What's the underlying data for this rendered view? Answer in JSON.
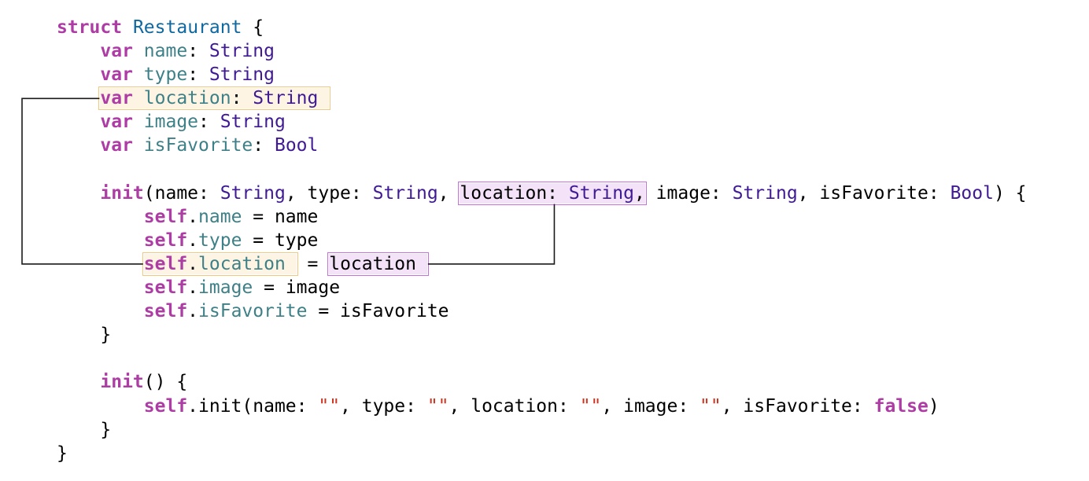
{
  "code_lines": [
    {
      "indent": 0,
      "tokens": [
        {
          "text": "struct",
          "kind": "struct"
        },
        {
          "text": " ",
          "kind": "plain"
        },
        {
          "text": "Restaurant",
          "kind": "typedef"
        },
        {
          "text": " {",
          "kind": "plain"
        }
      ]
    },
    {
      "indent": 1,
      "tokens": [
        {
          "text": "var",
          "kind": "keyword"
        },
        {
          "text": " ",
          "kind": "plain"
        },
        {
          "text": "name",
          "kind": "prop"
        },
        {
          "text": ": ",
          "kind": "plain"
        },
        {
          "text": "String",
          "kind": "type"
        }
      ]
    },
    {
      "indent": 1,
      "tokens": [
        {
          "text": "var",
          "kind": "keyword"
        },
        {
          "text": " ",
          "kind": "plain"
        },
        {
          "text": "type",
          "kind": "prop"
        },
        {
          "text": ": ",
          "kind": "plain"
        },
        {
          "text": "String",
          "kind": "type"
        }
      ]
    },
    {
      "indent": 1,
      "highlight_line": "orange",
      "tokens": [
        {
          "text": "var",
          "kind": "keyword"
        },
        {
          "text": " ",
          "kind": "plain"
        },
        {
          "text": "location",
          "kind": "prop"
        },
        {
          "text": ": ",
          "kind": "plain"
        },
        {
          "text": "String",
          "kind": "type"
        },
        {
          "text": " ",
          "kind": "plain"
        }
      ]
    },
    {
      "indent": 1,
      "tokens": [
        {
          "text": "var",
          "kind": "keyword"
        },
        {
          "text": " ",
          "kind": "plain"
        },
        {
          "text": "image",
          "kind": "prop"
        },
        {
          "text": ": ",
          "kind": "plain"
        },
        {
          "text": "String",
          "kind": "type"
        }
      ]
    },
    {
      "indent": 1,
      "tokens": [
        {
          "text": "var",
          "kind": "keyword"
        },
        {
          "text": " ",
          "kind": "plain"
        },
        {
          "text": "isFavorite",
          "kind": "prop"
        },
        {
          "text": ": ",
          "kind": "plain"
        },
        {
          "text": "Bool",
          "kind": "type"
        }
      ]
    },
    {
      "indent": 0,
      "tokens": []
    },
    {
      "indent": 1,
      "tokens": [
        {
          "text": "init",
          "kind": "keyword"
        },
        {
          "text": "(name: ",
          "kind": "plain"
        },
        {
          "text": "String",
          "kind": "type"
        },
        {
          "text": ", type: ",
          "kind": "plain"
        },
        {
          "text": "String",
          "kind": "type"
        },
        {
          "text": ", ",
          "kind": "plain"
        },
        {
          "group": "purple",
          "id": "param-location",
          "tokens": [
            {
              "text": "location: ",
              "kind": "plain"
            },
            {
              "text": "String",
              "kind": "type"
            },
            {
              "text": ",",
              "kind": "plain"
            }
          ]
        },
        {
          "text": " image: ",
          "kind": "plain"
        },
        {
          "text": "String",
          "kind": "type"
        },
        {
          "text": ", isFavorite: ",
          "kind": "plain"
        },
        {
          "text": "Bool",
          "kind": "type"
        },
        {
          "text": ") {",
          "kind": "plain"
        }
      ]
    },
    {
      "indent": 2,
      "tokens": [
        {
          "text": "self",
          "kind": "self"
        },
        {
          "text": ".",
          "kind": "plain"
        },
        {
          "text": "name",
          "kind": "prop"
        },
        {
          "text": " = name",
          "kind": "plain"
        }
      ]
    },
    {
      "indent": 2,
      "tokens": [
        {
          "text": "self",
          "kind": "self"
        },
        {
          "text": ".",
          "kind": "plain"
        },
        {
          "text": "type",
          "kind": "prop"
        },
        {
          "text": " = type",
          "kind": "plain"
        }
      ]
    },
    {
      "indent": 2,
      "tokens": [
        {
          "group": "orange",
          "id": "self-location",
          "tokens": [
            {
              "text": "self",
              "kind": "self"
            },
            {
              "text": ".",
              "kind": "plain"
            },
            {
              "text": "location",
              "kind": "prop"
            },
            {
              "text": " ",
              "kind": "plain"
            }
          ]
        },
        {
          "text": " = ",
          "kind": "plain"
        },
        {
          "group": "purple",
          "id": "assign-location",
          "tokens": [
            {
              "text": "location",
              "kind": "plain"
            },
            {
              "text": " ",
              "kind": "plain"
            }
          ]
        }
      ]
    },
    {
      "indent": 2,
      "tokens": [
        {
          "text": "self",
          "kind": "self"
        },
        {
          "text": ".",
          "kind": "plain"
        },
        {
          "text": "image",
          "kind": "prop"
        },
        {
          "text": " = image",
          "kind": "plain"
        }
      ]
    },
    {
      "indent": 2,
      "tokens": [
        {
          "text": "self",
          "kind": "self"
        },
        {
          "text": ".",
          "kind": "plain"
        },
        {
          "text": "isFavorite",
          "kind": "prop"
        },
        {
          "text": " = isFavorite",
          "kind": "plain"
        }
      ]
    },
    {
      "indent": 1,
      "tokens": [
        {
          "text": "}",
          "kind": "plain"
        }
      ]
    },
    {
      "indent": 0,
      "tokens": []
    },
    {
      "indent": 1,
      "tokens": [
        {
          "text": "init",
          "kind": "keyword"
        },
        {
          "text": "() {",
          "kind": "plain"
        }
      ]
    },
    {
      "indent": 2,
      "tokens": [
        {
          "text": "self",
          "kind": "self"
        },
        {
          "text": ".init(name: ",
          "kind": "plain"
        },
        {
          "text": "\"\"",
          "kind": "str"
        },
        {
          "text": ", type: ",
          "kind": "plain"
        },
        {
          "text": "\"\"",
          "kind": "str"
        },
        {
          "text": ", location: ",
          "kind": "plain"
        },
        {
          "text": "\"\"",
          "kind": "str"
        },
        {
          "text": ", image: ",
          "kind": "plain"
        },
        {
          "text": "\"\"",
          "kind": "str"
        },
        {
          "text": ", isFavorite: ",
          "kind": "plain"
        },
        {
          "text": "false",
          "kind": "keyword"
        },
        {
          "text": ")",
          "kind": "plain"
        }
      ]
    },
    {
      "indent": 1,
      "tokens": [
        {
          "text": "}",
          "kind": "plain"
        }
      ]
    },
    {
      "indent": 0,
      "tokens": [
        {
          "text": "}",
          "kind": "plain"
        }
      ]
    }
  ],
  "colors": {
    "keyword": "#AD3DA4",
    "type": "#3F1A94",
    "type_declaration": "#0F68A0",
    "property": "#3E8087",
    "string": "#D12F1B",
    "highlight_orange": "#F5C77E",
    "highlight_purple": "#C770E0",
    "connector": "#1a1a1a"
  }
}
